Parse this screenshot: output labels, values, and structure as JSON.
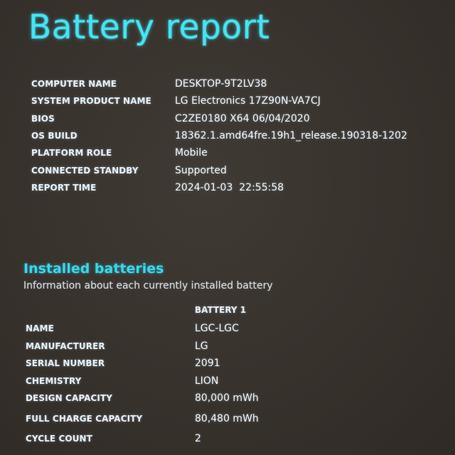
{
  "header": {
    "title": "Battery report"
  },
  "system_info": [
    {
      "label": "COMPUTER NAME",
      "value": "DESKTOP-9T2LV38"
    },
    {
      "label": "SYSTEM PRODUCT NAME",
      "value": "LG Electronics 17Z90N-VA7CJ"
    },
    {
      "label": "BIOS",
      "value": "C2ZE0180 X64 06/04/2020"
    },
    {
      "label": "OS BUILD",
      "value": "18362.1.amd64fre.19h1_release.190318-1202"
    },
    {
      "label": "PLATFORM ROLE",
      "value": "Mobile"
    },
    {
      "label": "CONNECTED STANDBY",
      "value": "Supported"
    },
    {
      "label": "REPORT TIME",
      "value": "2024-01-03  22:55:58"
    }
  ],
  "installed_batteries": {
    "title": "Installed batteries",
    "subtitle": "Information about each currently installed battery",
    "column_header": "BATTERY 1",
    "rows": [
      {
        "label": "NAME",
        "value": "LGC-LGC"
      },
      {
        "label": "MANUFACTURER",
        "value": "LG"
      },
      {
        "label": "SERIAL NUMBER",
        "value": "2091"
      },
      {
        "label": "CHEMISTRY",
        "value": "LION"
      },
      {
        "label": "DESIGN CAPACITY",
        "value": "80,000 mWh"
      },
      {
        "label": "FULL CHARGE CAPACITY",
        "value": "80,480 mWh"
      },
      {
        "label": "CYCLE COUNT",
        "value": "2"
      }
    ]
  },
  "colors": {
    "background": "#3a342f",
    "title_accent": "#44e4f4",
    "section_accent": "#36d8ec",
    "text": "#eef3f6"
  }
}
